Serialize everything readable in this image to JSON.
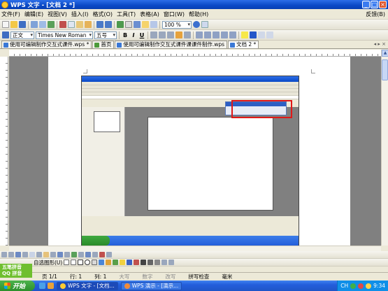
{
  "window": {
    "title": "WPS 文字 - [文档 2 *]"
  },
  "menu": {
    "items": [
      "文件(F)",
      "编辑(E)",
      "视图(V)",
      "插入(I)",
      "格式(O)",
      "工具(T)",
      "表格(A)",
      "窗口(W)",
      "帮助(H)"
    ],
    "help": "反馈(B)"
  },
  "toolbar": {
    "zoom": "100 %"
  },
  "format": {
    "style": "正文",
    "font": "Times New Roman",
    "size": "五号",
    "bold": "B",
    "italic": "I",
    "underline": "U"
  },
  "tabs": [
    {
      "label": "使用可编辑制作交互式课件.wps *"
    },
    {
      "label": "首页"
    },
    {
      "label": "使用可编辑制作交互式课件课课件制作.wps"
    },
    {
      "label": "文档 2 *"
    }
  ],
  "drawing": {
    "label": "自选图形(U)"
  },
  "qq": {
    "line1": "五笔拼音",
    "line2": "QQ 拼音"
  },
  "status": {
    "page": "页 1/1",
    "line": "行: 1",
    "col": "列: 1",
    "caps": "大写",
    "num": "数字",
    "mode": "改写",
    "spell": "拼写检查",
    "unit": "毫米"
  },
  "taskbar": {
    "start": "开始",
    "tasks": [
      {
        "label": "WPS 文字 - [文档..."
      },
      {
        "label": "WPS 演示 - [演示..."
      }
    ],
    "lang": "CH",
    "clock": "9:34"
  },
  "colors": {
    "titlebar": "#0a49c6",
    "highlight": "#e01818",
    "taskbar": "#245edb",
    "start": "#2c8f2c"
  }
}
